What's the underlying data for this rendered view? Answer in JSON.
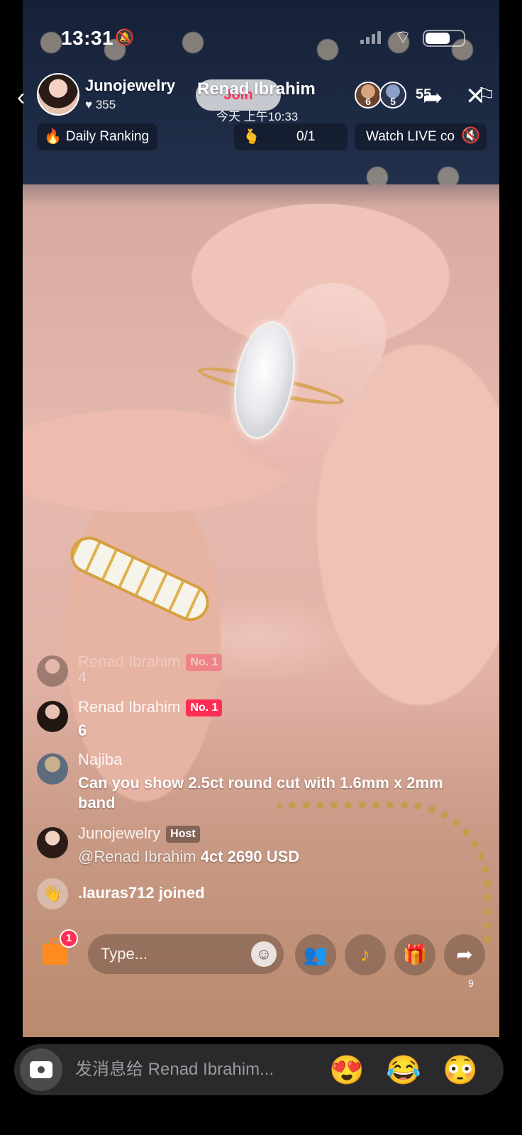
{
  "status_bar": {
    "time": "13:31"
  },
  "live": {
    "host_name": "Junojewelry",
    "host_likes": "355",
    "join_label": "Join",
    "chat_partner": "Renad Ibrahim",
    "chat_time": "今天 上午10:33",
    "viewers": [
      {
        "rank": "6"
      },
      {
        "rank": "5"
      }
    ],
    "viewer_count": "55",
    "daily_ranking": "Daily Ranking",
    "goal_count": "0/1",
    "watch_label": "Watch LIVE co"
  },
  "comments": [
    {
      "user": "Renad Ibrahim",
      "badge": "No. 1",
      "message": "4"
    },
    {
      "user": "Renad Ibrahim",
      "badge": "No. 1",
      "message": "6"
    },
    {
      "user": "Najiba",
      "message": "Can you show 2.5ct round cut with 1.6mm x 2mm band"
    },
    {
      "user": "Junojewelry",
      "badge": "Host",
      "mention": "@Renad Ibrahim",
      "message": "4ct 2690 USD"
    },
    {
      "user": ".lauras712",
      "joined_text": "joined"
    }
  ],
  "action_bar": {
    "shop_badge": "1",
    "type_placeholder": "Type...",
    "share_count": "9"
  },
  "message_bar": {
    "placeholder": "发消息给 Renad Ibrahim...",
    "quick_emojis": [
      "😍",
      "😂",
      "😳"
    ]
  },
  "icons": {
    "back": "chevron-left-icon",
    "share": "share-arrow-icon",
    "close": "close-icon",
    "flag": "flag-icon",
    "camera": "camera-icon"
  },
  "colors": {
    "accent": "#ff2d55",
    "shop": "#ff8a1f",
    "bottom_bar": "#2a2a2c"
  }
}
